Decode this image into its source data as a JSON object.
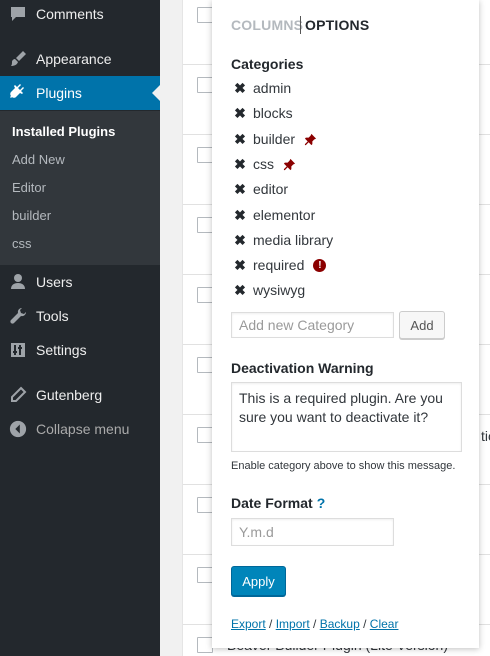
{
  "sidebar": {
    "menu": [
      {
        "label": "Comments",
        "icon": "comment-icon"
      },
      {
        "label": "Appearance",
        "icon": "paintbrush-icon"
      },
      {
        "label": "Plugins",
        "icon": "plugin-icon",
        "current": true
      },
      {
        "label": "Users",
        "icon": "user-icon"
      },
      {
        "label": "Tools",
        "icon": "wrench-icon"
      },
      {
        "label": "Settings",
        "icon": "settings-icon"
      },
      {
        "label": "Gutenberg",
        "icon": "pencil-icon"
      },
      {
        "label": "Collapse menu",
        "icon": "collapse-arrow-icon"
      }
    ],
    "submenu": [
      "Installed Plugins",
      "Add New",
      "Editor",
      "builder",
      "css"
    ]
  },
  "background": {
    "peek_right": "tio",
    "peek_bottom": "Beaver Builder Plugin (Lite Version)"
  },
  "panel": {
    "tab_columns": "COLUMNS",
    "tab_options": "OPTIONS",
    "categories_title": "Categories",
    "categories": [
      {
        "name": "admin"
      },
      {
        "name": "blocks"
      },
      {
        "name": "builder",
        "flag": "pin"
      },
      {
        "name": "css",
        "flag": "pin"
      },
      {
        "name": "editor"
      },
      {
        "name": "elementor"
      },
      {
        "name": "media library"
      },
      {
        "name": "required",
        "flag": "alert"
      },
      {
        "name": "wysiwyg"
      }
    ],
    "remove_glyph": "✖",
    "alert_glyph": "!",
    "add_category_placeholder": "Add new Category",
    "add_button": "Add",
    "deactivation_title": "Deactivation Warning",
    "deactivation_text": "This is a required plugin. Are you sure you want to deactivate it?",
    "deactivation_help": "Enable category above to show this message.",
    "date_format_title": "Date Format",
    "date_format_help": "?",
    "date_format_placeholder": "Y.m.d",
    "apply_button": "Apply",
    "footer": {
      "export": "Export",
      "import": "Import",
      "backup": "Backup",
      "clear": "Clear",
      "separator": " / "
    }
  },
  "colors": {
    "sidebar_bg": "#23282d",
    "submenu_bg": "#32373c",
    "accent": "#0073aa",
    "button_primary": "#0085ba",
    "pin": "#8b0000"
  }
}
